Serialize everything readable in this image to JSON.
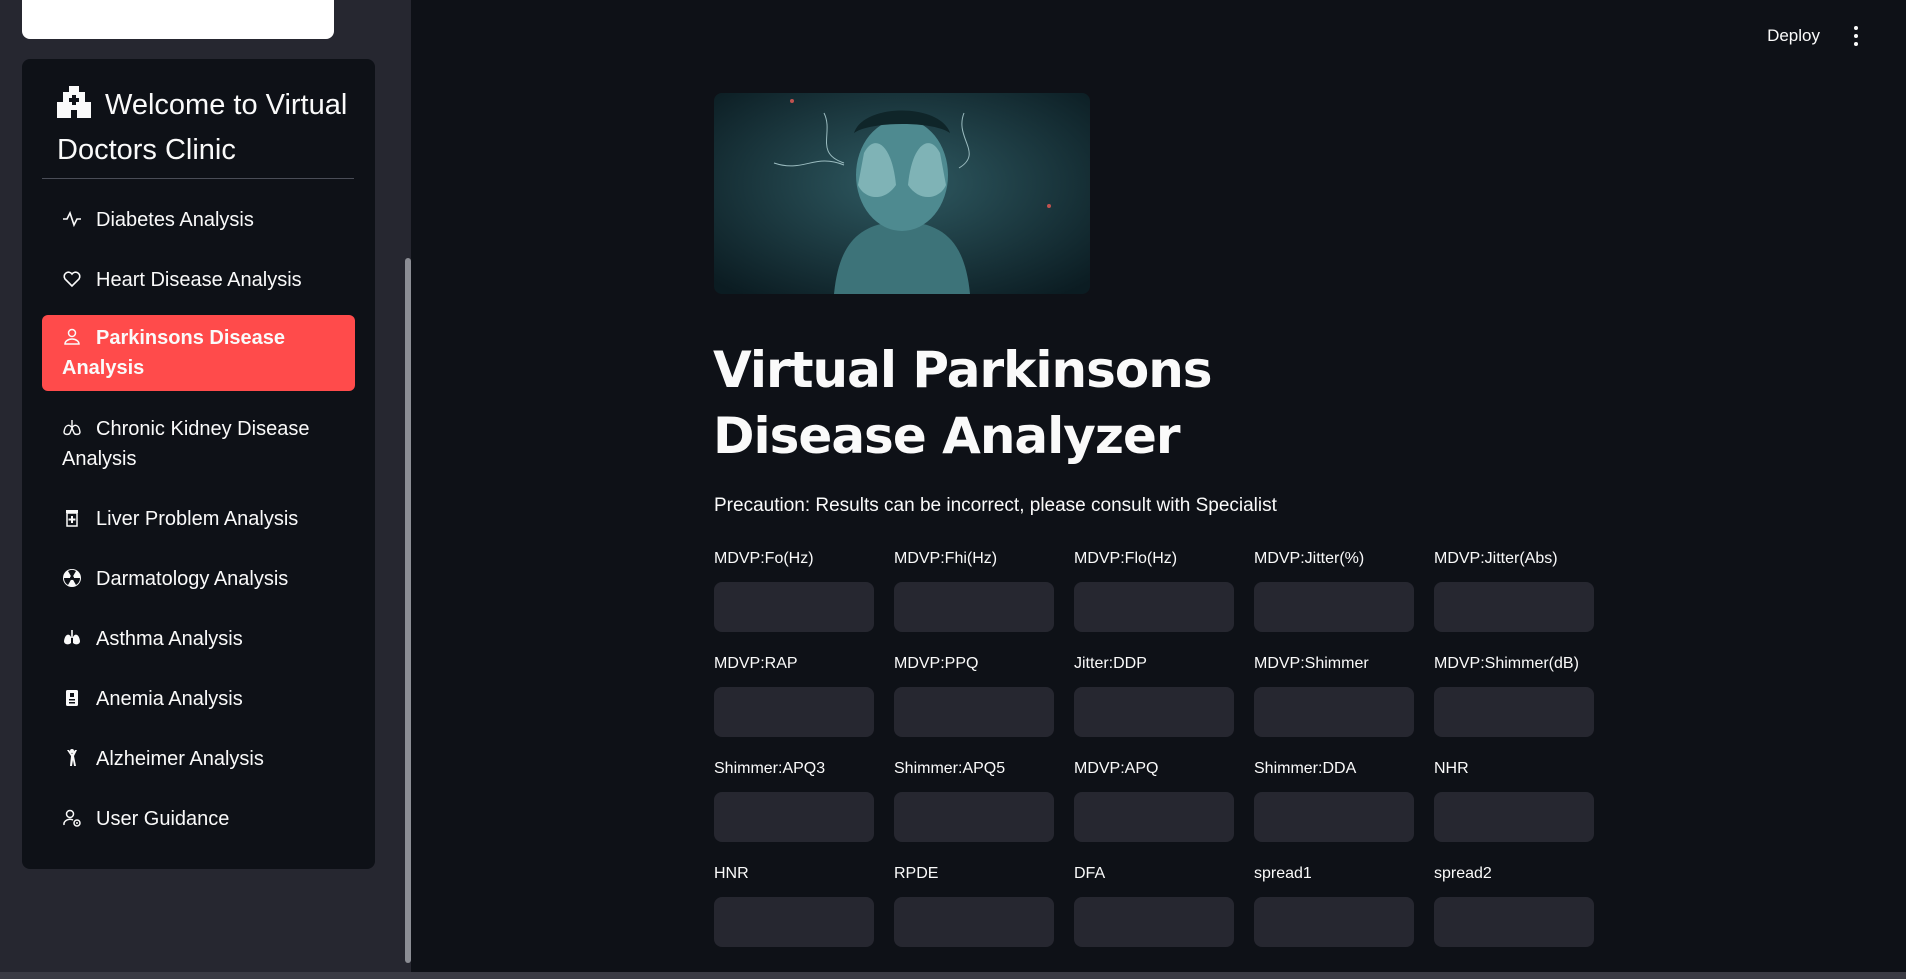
{
  "sidebar": {
    "logo_icon": "clinic-logo",
    "header": {
      "icon": "hospital-icon",
      "title": "Welcome to Virtual Doctors Clinic"
    },
    "items": [
      {
        "label": "Diabetes Analysis",
        "icon": "activity-icon",
        "active": false
      },
      {
        "label": "Heart Disease Analysis",
        "icon": "heart-icon",
        "active": false
      },
      {
        "label": "Parkinsons Disease Analysis",
        "icon": "person-icon",
        "active": true
      },
      {
        "label": "Chronic Kidney Disease Analysis",
        "icon": "lungs-icon",
        "active": false
      },
      {
        "label": "Liver Problem Analysis",
        "icon": "capsule-icon",
        "active": false
      },
      {
        "label": "Darmatology Analysis",
        "icon": "radioactive-icon",
        "active": false
      },
      {
        "label": "Asthma Analysis",
        "icon": "lungs-filled-icon",
        "active": false
      },
      {
        "label": "Anemia Analysis",
        "icon": "clipboard-icon",
        "active": false
      },
      {
        "label": "Alzheimer Analysis",
        "icon": "person-arms-up-icon",
        "active": false
      },
      {
        "label": "User Guidance",
        "icon": "person-gear-icon",
        "active": false
      }
    ],
    "active_color": "#ff4b4b"
  },
  "topbar": {
    "deploy_label": "Deploy",
    "menu_icon": "kebab-menu-icon"
  },
  "main": {
    "hero_image": "person-covering-face-image",
    "title": "Virtual Parkinsons Disease Analyzer",
    "precaution": "Precaution: Results can be incorrect, please consult with Specialist",
    "fields": [
      {
        "label": "MDVP:Fo(Hz)",
        "value": ""
      },
      {
        "label": "MDVP:Fhi(Hz)",
        "value": ""
      },
      {
        "label": "MDVP:Flo(Hz)",
        "value": ""
      },
      {
        "label": "MDVP:Jitter(%)",
        "value": ""
      },
      {
        "label": "MDVP:Jitter(Abs)",
        "value": ""
      },
      {
        "label": "MDVP:RAP",
        "value": ""
      },
      {
        "label": "MDVP:PPQ",
        "value": ""
      },
      {
        "label": "Jitter:DDP",
        "value": ""
      },
      {
        "label": "MDVP:Shimmer",
        "value": ""
      },
      {
        "label": "MDVP:Shimmer(dB)",
        "value": ""
      },
      {
        "label": "Shimmer:APQ3",
        "value": ""
      },
      {
        "label": "Shimmer:APQ5",
        "value": ""
      },
      {
        "label": "MDVP:APQ",
        "value": ""
      },
      {
        "label": "Shimmer:DDA",
        "value": ""
      },
      {
        "label": "NHR",
        "value": ""
      },
      {
        "label": "HNR",
        "value": ""
      },
      {
        "label": "RPDE",
        "value": ""
      },
      {
        "label": "DFA",
        "value": ""
      },
      {
        "label": "spread1",
        "value": ""
      },
      {
        "label": "spread2",
        "value": ""
      }
    ]
  }
}
